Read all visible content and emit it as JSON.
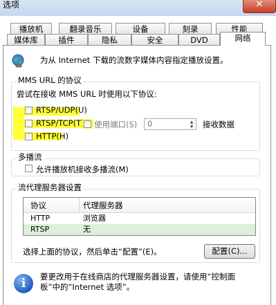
{
  "window": {
    "title": "选项",
    "close_label": "✕"
  },
  "tabs_back": [
    "播放机",
    "翻录音乐",
    "设备",
    "刻录",
    "性能"
  ],
  "tabs_front": [
    "媒体库",
    "插件",
    "隐私",
    "安全",
    "DVD",
    "网络"
  ],
  "active_tab": "网络",
  "intro_text": "为从 Internet 下载的流数字媒体内容指定播放设置。",
  "mms": {
    "group_label": "MMS URL 的协议",
    "instruction": "尝试在接收 MMS URL 时使用以下协议:",
    "protocols": [
      {
        "label": "RTSP/UDP(U)",
        "checked": false
      },
      {
        "label": "RTSP/TCP(T)",
        "checked": false
      },
      {
        "label": "HTTP(H)",
        "checked": false
      }
    ],
    "use_port_label": "使用端口(S)",
    "use_port_checked": false,
    "port_value": "0",
    "port_suffix": "接收数据",
    "highlight_color": "#ffff3a"
  },
  "multicast": {
    "group_label": "多播流",
    "checkbox_label": "允许播放机接收多播流(M)",
    "checked": false
  },
  "proxy": {
    "group_label": "流代理服务器设置",
    "columns": [
      "协议",
      "代理服务器"
    ],
    "rows": [
      {
        "protocol": "HTTP",
        "server": "浏览器"
      },
      {
        "protocol": "RTSP",
        "server": "无"
      }
    ],
    "selected_row_color": "#dcefd9",
    "hint": "选择上面的协议，然后单击“配置”(E)。",
    "configure_button": "配置(C)..."
  },
  "footer_note_line1": "要更改用于在线商店的代理服务器设置，请使用“控制面",
  "footer_note_line2": "板”中的“Internet 选项”。"
}
